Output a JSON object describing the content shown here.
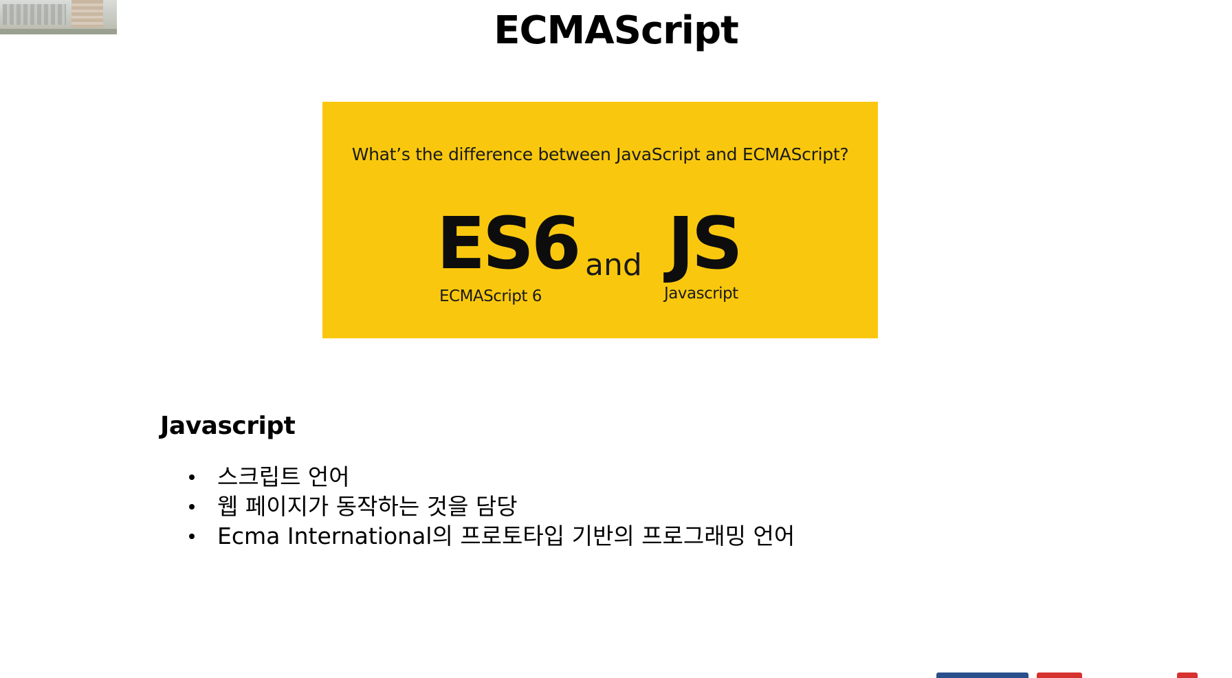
{
  "slide": {
    "title": "ECMAScript"
  },
  "banner": {
    "question": "What’s the difference between JavaScript and ECMAScript?",
    "left_big": "ES6",
    "middle": "and",
    "right_big": "JS",
    "left_caption": "ECMAScript 6",
    "right_caption": "Javascript",
    "background_color": "#f9c80e"
  },
  "section": {
    "heading": "Javascript",
    "bullets": [
      "스크립트 언어",
      "웹 페이지가 동작하는 것을 담당",
      "Ecma International의 프로토타입 기반의 프로그래밍 언어"
    ]
  },
  "corner_image": {
    "icon": "building-photo"
  },
  "footer": {
    "icon": "organization-logo",
    "colors": [
      "#2b4f8c",
      "#d6322f"
    ]
  }
}
